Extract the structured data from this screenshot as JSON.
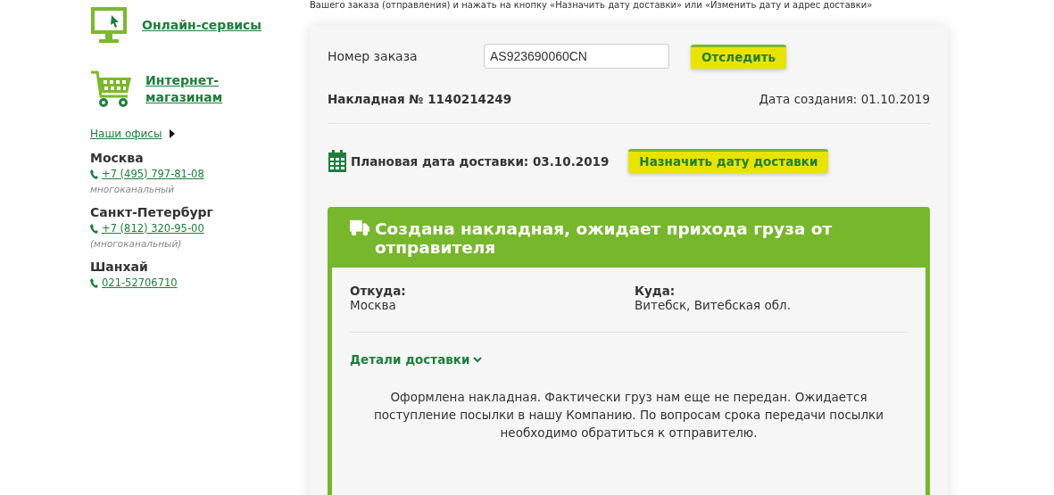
{
  "sidebar": {
    "services": [
      {
        "kind": "monitor",
        "label": "Онлайн-сервисы"
      },
      {
        "kind": "cart",
        "label": "Интернет-магазинам"
      }
    ],
    "offices_link": "Наши офисы",
    "offices": [
      {
        "city": "Москва",
        "phone": "+7 (495) 797-81-08",
        "note": "многоканальный"
      },
      {
        "city": "Санкт-Петербург",
        "phone": "+7 (812) 320-95-00",
        "note": "(многоканальный)"
      },
      {
        "city": "Шанхай",
        "phone": "021-52706710"
      }
    ]
  },
  "intro_text": "Вашего заказа (отправления) и нажать на кнопку «Назначить дату доставки» или «Изменить дату и адрес доставки»",
  "tracking": {
    "label": "Номер заказа",
    "value": "AS923690060CN",
    "button": "Отследить"
  },
  "waybill": {
    "number": "Накладная № 1140214249",
    "created": "Дата создания: 01.10.2019"
  },
  "planned": {
    "text": "Плановая дата доставки: 03.10.2019",
    "button": "Назначить дату доставки"
  },
  "status": {
    "title": "Создана накладная, ожидает прихода груза от отправителя",
    "from_label": "Откуда:",
    "from": "Москва",
    "to_label": "Куда:",
    "to": "Витебск, Витебская обл.",
    "details_link": "Детали доставки",
    "message": "Оформлена накладная. Фактически груз нам еще не передан. Ожидается поступление посылки в нашу Компанию. По вопросам срока передачи посылки необходимо обратиться к отправителю."
  }
}
